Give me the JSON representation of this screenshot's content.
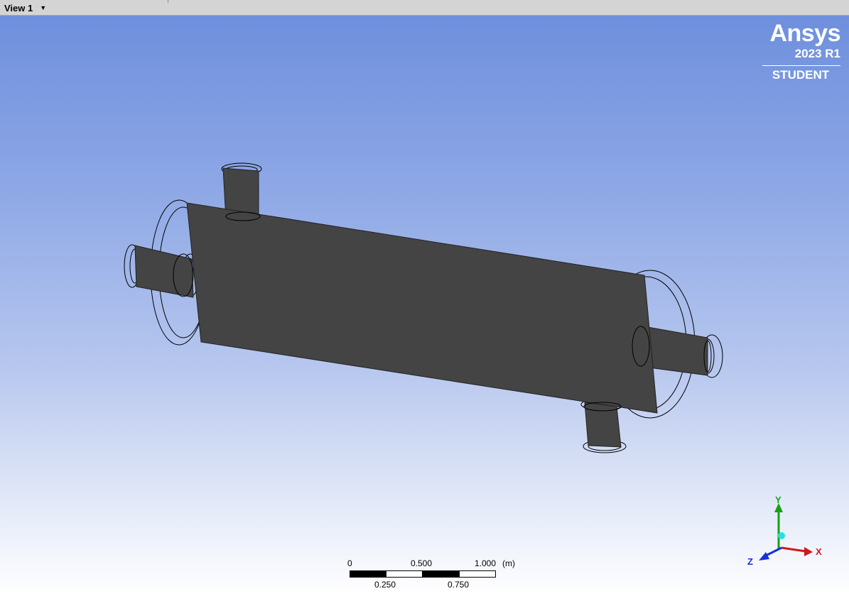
{
  "view_tab": {
    "label": "View 1",
    "caret": "▼"
  },
  "logo": {
    "brand": "Ansys",
    "version": "2023 R1",
    "edition": "STUDENT"
  },
  "scale_bar": {
    "top_labels": [
      "0",
      "0.500",
      "1.000"
    ],
    "unit": "(m)",
    "bottom_labels": [
      "0.250",
      "0.750"
    ]
  },
  "triad": {
    "x_label": "X",
    "y_label": "Y",
    "z_label": "Z",
    "colors": {
      "x": "#d01818",
      "y": "#18a018",
      "z": "#1830d8",
      "origin": "#28e0e0"
    }
  },
  "colors": {
    "model_fill": "#444444",
    "model_edge": "#000000",
    "bg_top": "#6e8fdd",
    "bg_bottom": "#ffffff"
  }
}
